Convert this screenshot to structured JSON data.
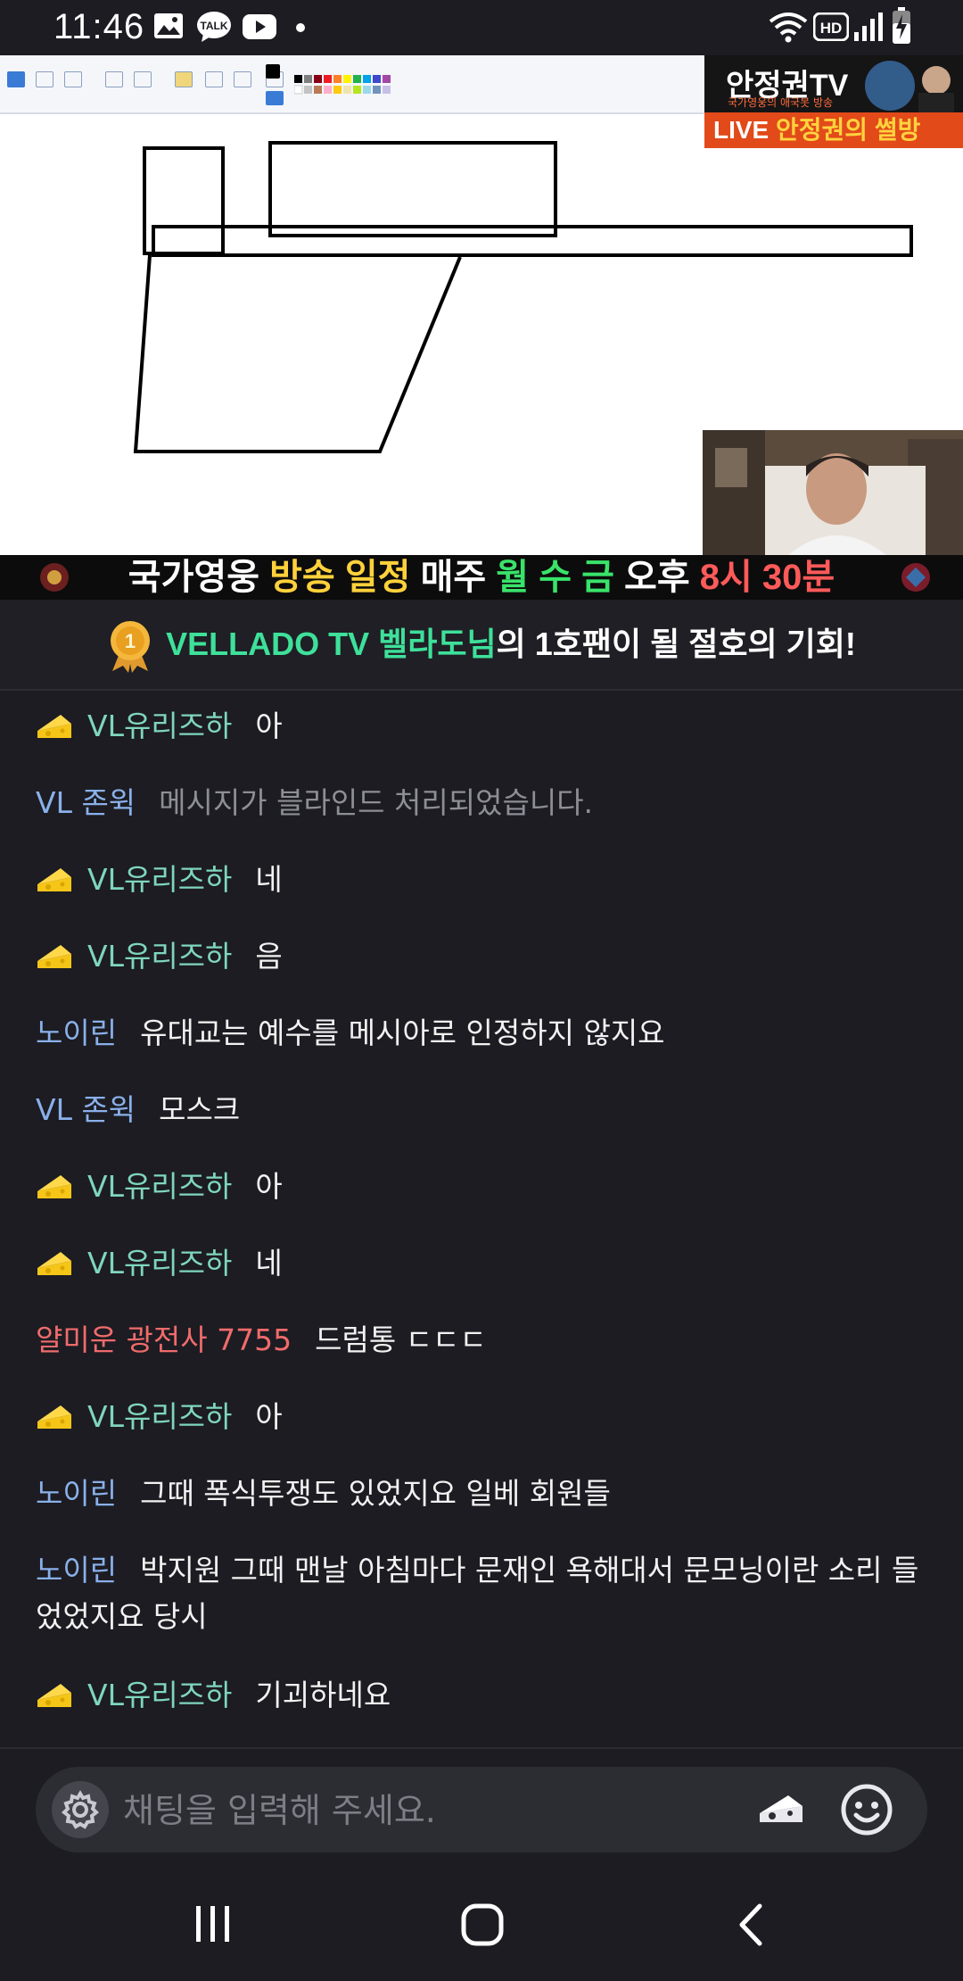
{
  "status_bar": {
    "time": "11:46",
    "notifications": [
      "gallery-icon",
      "kakaotalk-icon",
      "youtube-icon",
      "dot-icon"
    ],
    "talk_label": "TALK",
    "hd_label": "HD",
    "system_icons": [
      "wifi-icon",
      "hd-voice-icon",
      "signal-icon",
      "battery-charging-icon"
    ]
  },
  "video": {
    "channel_name": "안정권TV",
    "channel_tagline": "국가영웅의 애국봇 방송",
    "live_badge": "LIVE",
    "live_title": "안정권의 썰방"
  },
  "schedule_banner": {
    "part1": "국가영웅 ",
    "part2": "방송 일정",
    "part3": " 매주 ",
    "part4": "월 수 금",
    "part5": " 오후 ",
    "part6": "8시 30분"
  },
  "fan_banner": {
    "medal_number": "1",
    "highlight": "VELLADO TV 벨라도님",
    "rest": "의 1호팬이 될 절호의 기회!"
  },
  "chat": {
    "messages": [
      {
        "nick": "VL유리즈하",
        "text": "아",
        "badge": "cheese"
      },
      {
        "nick": "VL 존윅",
        "text": "메시지가 블라인드 처리되었습니다."
      },
      {
        "nick": "VL유리즈하",
        "text": "네",
        "badge": "cheese"
      },
      {
        "nick": "VL유리즈하",
        "text": "음",
        "badge": "cheese"
      },
      {
        "nick": "노이린",
        "text": "유대교는 예수를 메시아로 인정하지 않지요"
      },
      {
        "nick": "VL 존윅",
        "text": "모스크"
      },
      {
        "nick": "VL유리즈하",
        "text": "아",
        "badge": "cheese"
      },
      {
        "nick": "VL유리즈하",
        "text": "네",
        "badge": "cheese"
      },
      {
        "nick": "얄미운 광전사 7755",
        "text": "드럼통 ㄷㄷㄷ"
      },
      {
        "nick": "VL유리즈하",
        "text": "아",
        "badge": "cheese"
      },
      {
        "nick": "노이린",
        "text": "그때 폭식투쟁도 있었지요 일베 회원들"
      },
      {
        "nick": "노이린",
        "text": "박지원 그때 맨날 아침마다 문재인 욕해대서 문모닝이란 소리 들었었지요 당시"
      },
      {
        "nick": "VL유리즈하",
        "text": "기괴하네요",
        "badge": "cheese"
      }
    ]
  },
  "input": {
    "placeholder": "채팅을 입력해 주세요."
  },
  "colors": {
    "background": "#1c1c22",
    "nick_teal": "#7fd6bc",
    "nick_blue": "#8ab0ea",
    "nick_red": "#f06b6b",
    "banner_green": "#3ee09a",
    "schedule_yellow": "#ffd13b",
    "schedule_green": "#39e36a",
    "schedule_red": "#ff5a5a"
  }
}
